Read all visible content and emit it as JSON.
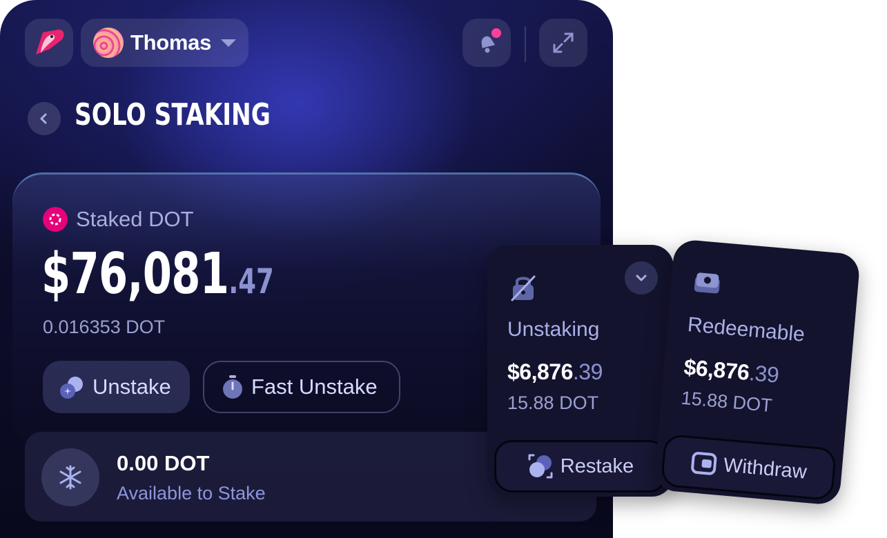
{
  "header": {
    "account_name": "Thomas",
    "has_notification": true
  },
  "page": {
    "title": "SOLO STAKING"
  },
  "staked": {
    "label": "Staked DOT",
    "amount_main": "$76,081",
    "amount_decimal": ".47",
    "dot_amount": "0.016353 DOT",
    "unstake_label": "Unstake",
    "fast_unstake_label": "Fast Unstake"
  },
  "available": {
    "amount": "0.00 DOT",
    "label": "Available to Stake"
  },
  "unstaking_card": {
    "label": "Unstaking",
    "amount_main": "$6,876",
    "amount_decimal": ".39",
    "dot_amount": "15.88 DOT",
    "action_label": "Restake"
  },
  "redeemable_card": {
    "label": "Redeemable",
    "amount_main": "$6,876",
    "amount_decimal": ".39",
    "dot_amount": "15.88 DOT",
    "action_label": "Withdraw"
  },
  "colors": {
    "accent_pink": "#e6007a",
    "notification_dot": "#ff3f9a",
    "panel_background": "#0d0d2c",
    "secondary_text": "#8c92d0"
  }
}
